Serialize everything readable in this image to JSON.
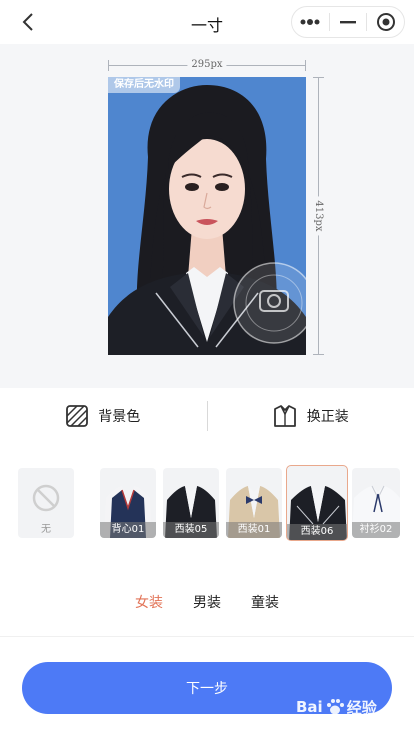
{
  "header": {
    "title": "一寸"
  },
  "preview": {
    "width_label": "295px",
    "height_label": "413px",
    "watermark_tag": "保存后无水印"
  },
  "tools": {
    "background_label": "背景色",
    "outfit_label": "换正装"
  },
  "outfits": [
    {
      "label": "无"
    },
    {
      "label": "背心01"
    },
    {
      "label": "西装05"
    },
    {
      "label": "西装01"
    },
    {
      "label": "西装06"
    },
    {
      "label": "衬衫02"
    }
  ],
  "categories": [
    {
      "label": "女装",
      "active": true
    },
    {
      "label": "男装",
      "active": false
    },
    {
      "label": "童装",
      "active": false
    }
  ],
  "footer": {
    "next_label": "下一步"
  },
  "baidu_watermark": {
    "brand": "Bai",
    "brand_tail": "经验",
    "url": "jingyan.baidu.com"
  },
  "colors": {
    "accent": "#4d7af6",
    "active_category": "#e27458",
    "photo_background": "#4f86cf"
  }
}
